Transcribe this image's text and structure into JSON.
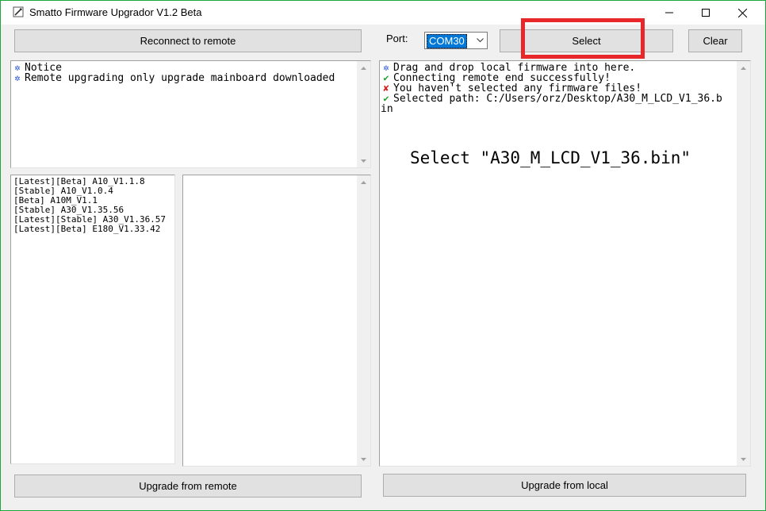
{
  "window": {
    "title": "Smatto Firmware Upgrador V1.2 Beta"
  },
  "toolbar": {
    "reconnect_label": "Reconnect to remote",
    "port_label": "Port:",
    "port_value": "COM30",
    "select_label": "Select",
    "clear_label": "Clear"
  },
  "notice_log": {
    "lines": [
      {
        "icon": "gear-icon",
        "text": "Notice"
      },
      {
        "icon": "gear-icon",
        "text": "Remote upgrading only upgrade mainboard downloaded"
      }
    ]
  },
  "firmware_list": {
    "items": [
      "[Latest][Beta] A10_V1.1.8",
      "[Stable] A10_V1.0.4",
      "[Beta] A10M_V1.1",
      "[Stable] A30_V1.35.56",
      "[Latest][Stable] A30_V1.36.57",
      "[Latest][Beta] E180_V1.33.42"
    ]
  },
  "local_log": {
    "lines": [
      {
        "icon": "gear-icon",
        "text": "Drag and drop local firmware into here."
      },
      {
        "icon": "check-icon",
        "text": "Connecting remote end successfully!"
      },
      {
        "icon": "cross-icon",
        "text": "You haven't selected any firmware files!"
      },
      {
        "icon": "check-icon",
        "text": "Selected path: C:/Users/orz/Desktop/A30_M_LCD_V1_36.b"
      },
      {
        "icon": "",
        "text": "in"
      }
    ]
  },
  "annotation": {
    "text": "Select \"A30_M_LCD_V1_36.bin\""
  },
  "footer": {
    "upgrade_remote_label": "Upgrade from remote",
    "upgrade_local_label": "Upgrade from local"
  },
  "colors": {
    "accent_border": "#1ba83a",
    "highlight": "#e8272b",
    "check": "#1fa02e",
    "cross": "#d42020",
    "gear": "#1f4fd6",
    "selection": "#0078d7"
  }
}
